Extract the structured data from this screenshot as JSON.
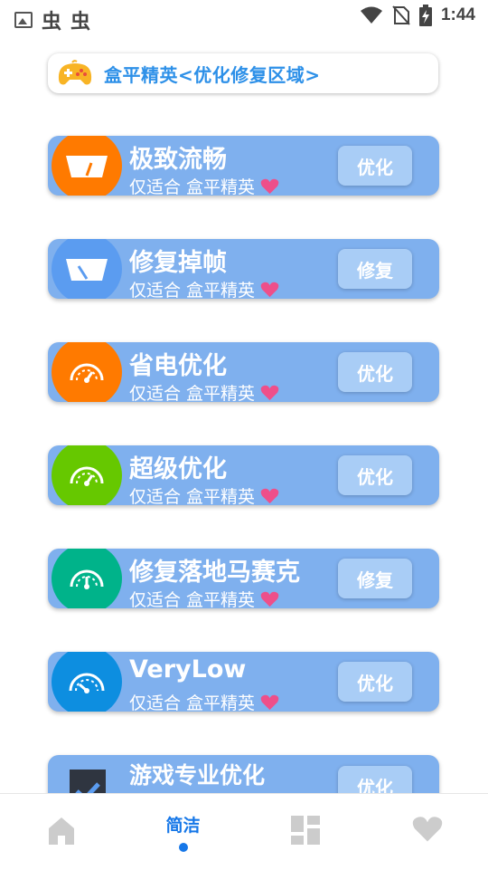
{
  "status_bar": {
    "app_glyphs": [
      "虫",
      "虫"
    ],
    "time": "1:44",
    "icons": [
      "image-icon",
      "wifi-icon",
      "no-sim-icon",
      "battery-charging-icon"
    ]
  },
  "header": {
    "title": "盒平精英<优化修复区域>",
    "icon": "gamepad-icon",
    "accent_color": "#2d90e8"
  },
  "cards": [
    {
      "title": "极致流畅",
      "subtitle": "仅适合 盒平精英",
      "button": "优化",
      "icon": "speedometer-icon",
      "icon_color": "#ff7a00"
    },
    {
      "title": "修复掉帧",
      "subtitle": "仅适合 盒平精英",
      "button": "修复",
      "icon": "speedometer-icon",
      "icon_color": "#5b9cf0"
    },
    {
      "title": "省电优化",
      "subtitle": "仅适合 盒平精英",
      "button": "优化",
      "icon": "gauge-icon",
      "icon_color": "#ff7a00"
    },
    {
      "title": "超级优化",
      "subtitle": "仅适合 盒平精英",
      "button": "优化",
      "icon": "gauge-icon",
      "icon_color": "#66c800"
    },
    {
      "title": "修复落地马赛克",
      "subtitle": "仅适合 盒平精英",
      "button": "修复",
      "icon": "gauge-icon",
      "icon_color": "#00b38a"
    },
    {
      "title": "VeryLow",
      "subtitle": "仅适合 盒平精英",
      "button": "优化",
      "icon": "gauge-icon",
      "icon_color": "#0d8ee0"
    },
    {
      "title": "游戏专业优化",
      "subtitle": "",
      "button": "优化",
      "icon": "shield-check-icon",
      "icon_color": "#333333"
    }
  ],
  "colors": {
    "card_bg": "#7fb0ee",
    "button_bg": "#a9cdf6",
    "heart": "#ee4f8a",
    "nav_active": "#1677e8",
    "nav_inactive": "#cccccc"
  },
  "bottom_nav": {
    "items": [
      {
        "label": "",
        "icon": "home-icon"
      },
      {
        "label": "简洁",
        "icon": "",
        "active": true
      },
      {
        "label": "",
        "icon": "dashboard-icon"
      },
      {
        "label": "",
        "icon": "heart-icon"
      }
    ]
  }
}
